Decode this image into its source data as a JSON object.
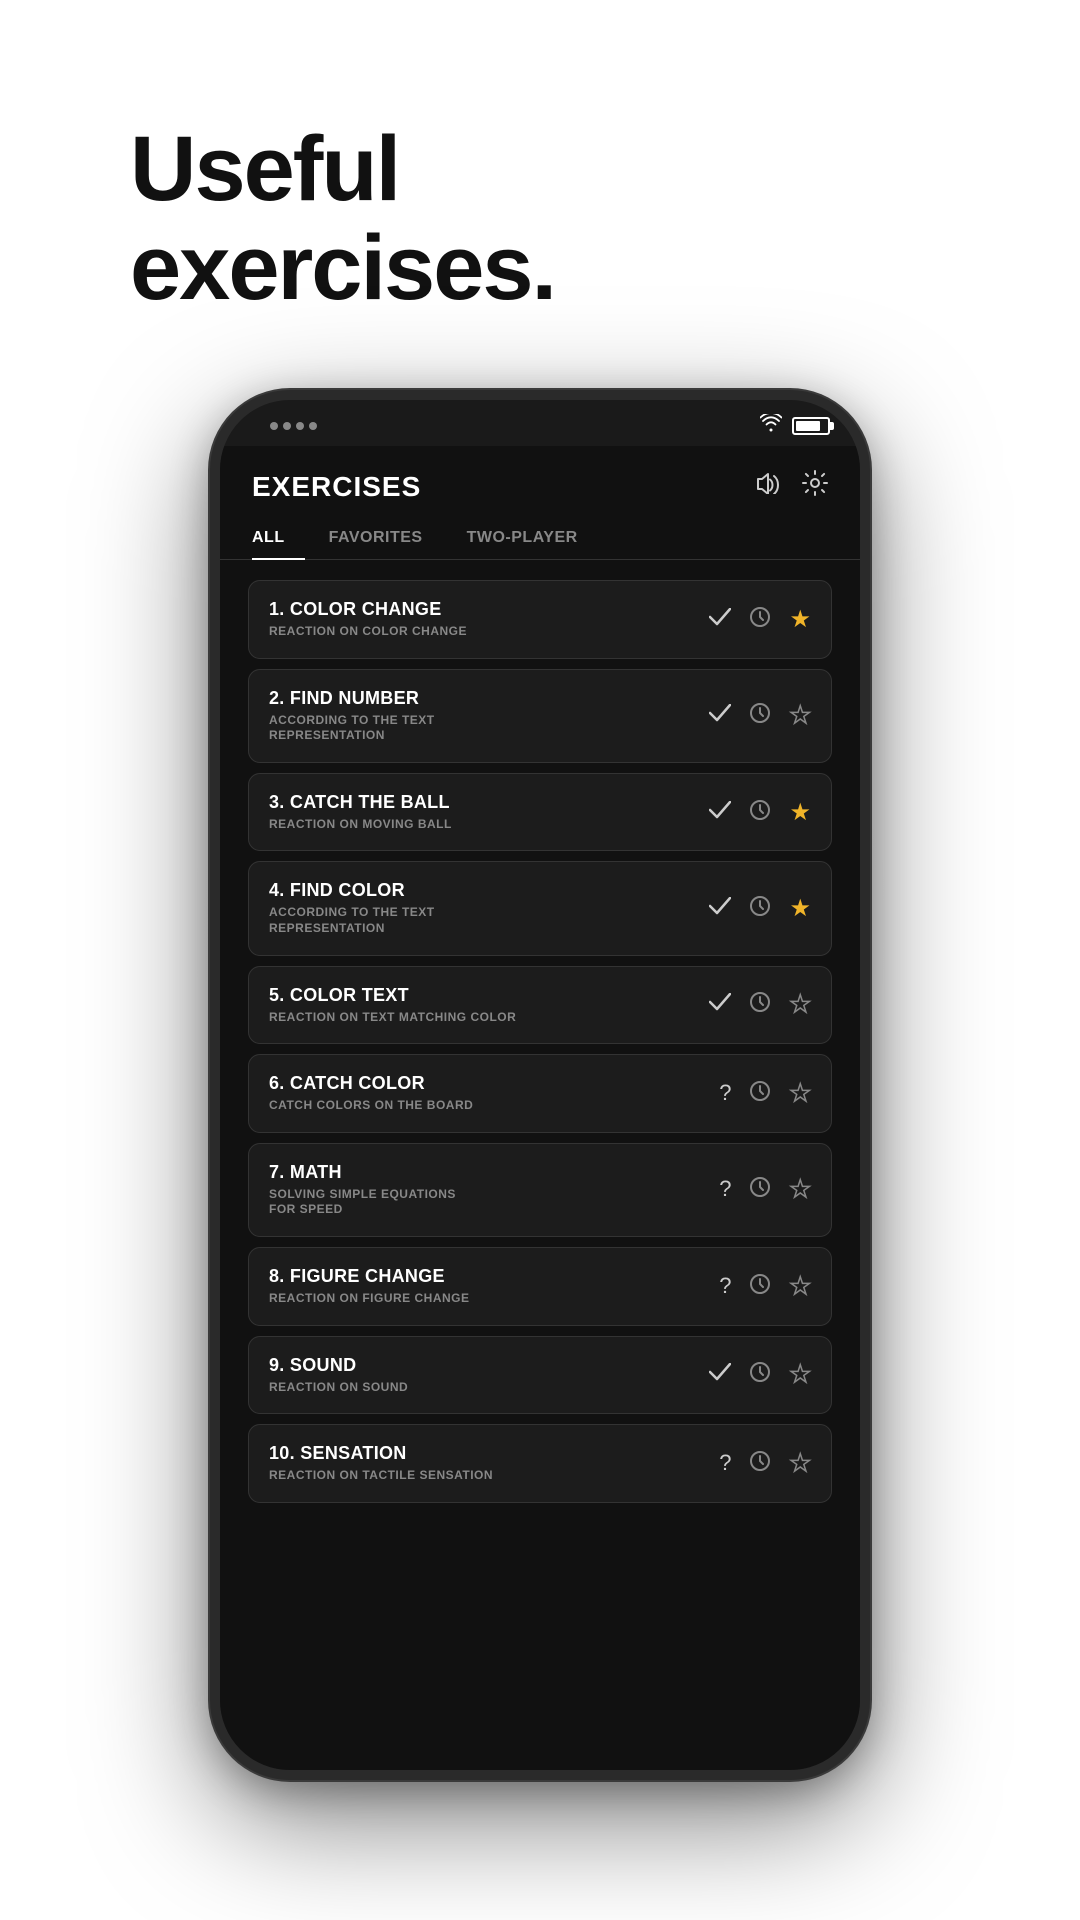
{
  "headline": {
    "line1": "Useful",
    "line2": "exercises."
  },
  "app": {
    "title": "EXERCISES",
    "sound_icon": "🔊",
    "settings_icon": "⚙️"
  },
  "tabs": [
    {
      "id": "all",
      "label": "ALL",
      "active": true
    },
    {
      "id": "favorites",
      "label": "FAVORITES",
      "active": false
    },
    {
      "id": "two-player",
      "label": "TWO-PLAYER",
      "active": false
    }
  ],
  "exercises": [
    {
      "number": "1.",
      "title": "COLOR CHANGE",
      "subtitle": "REACTION ON COLOR CHANGE",
      "status": "check",
      "favorite": true
    },
    {
      "number": "2.",
      "title": "FIND NUMBER",
      "subtitle": "ACCORDING TO THE TEXT\nREPRESENTATION",
      "status": "check",
      "favorite": false
    },
    {
      "number": "3.",
      "title": "CATCH THE BALL",
      "subtitle": "REACTION ON MOVING BALL",
      "status": "check",
      "favorite": true
    },
    {
      "number": "4.",
      "title": "FIND COLOR",
      "subtitle": "ACCORDING TO THE TEXT\nREPRESENTATION",
      "status": "check",
      "favorite": true
    },
    {
      "number": "5.",
      "title": "COLOR TEXT",
      "subtitle": "REACTION ON TEXT MATCHING COLOR",
      "status": "check",
      "favorite": false
    },
    {
      "number": "6.",
      "title": "CATCH COLOR",
      "subtitle": "CATCH COLORS ON THE BOARD",
      "status": "question",
      "favorite": false
    },
    {
      "number": "7.",
      "title": "MATH",
      "subtitle": "SOLVING SIMPLE EQUATIONS\nFOR SPEED",
      "status": "question",
      "favorite": false
    },
    {
      "number": "8.",
      "title": "FIGURE CHANGE",
      "subtitle": "REACTION ON FIGURE CHANGE",
      "status": "question",
      "favorite": false
    },
    {
      "number": "9.",
      "title": "SOUND",
      "subtitle": "REACTION ON SOUND",
      "status": "check",
      "favorite": false
    },
    {
      "number": "10.",
      "title": "SENSATION",
      "subtitle": "REACTION ON TACTILE SENSATION",
      "status": "question",
      "favorite": false
    }
  ],
  "colors": {
    "star_filled": "#f0b429",
    "star_empty_stroke": "#888888",
    "accent": "#ffffff"
  }
}
